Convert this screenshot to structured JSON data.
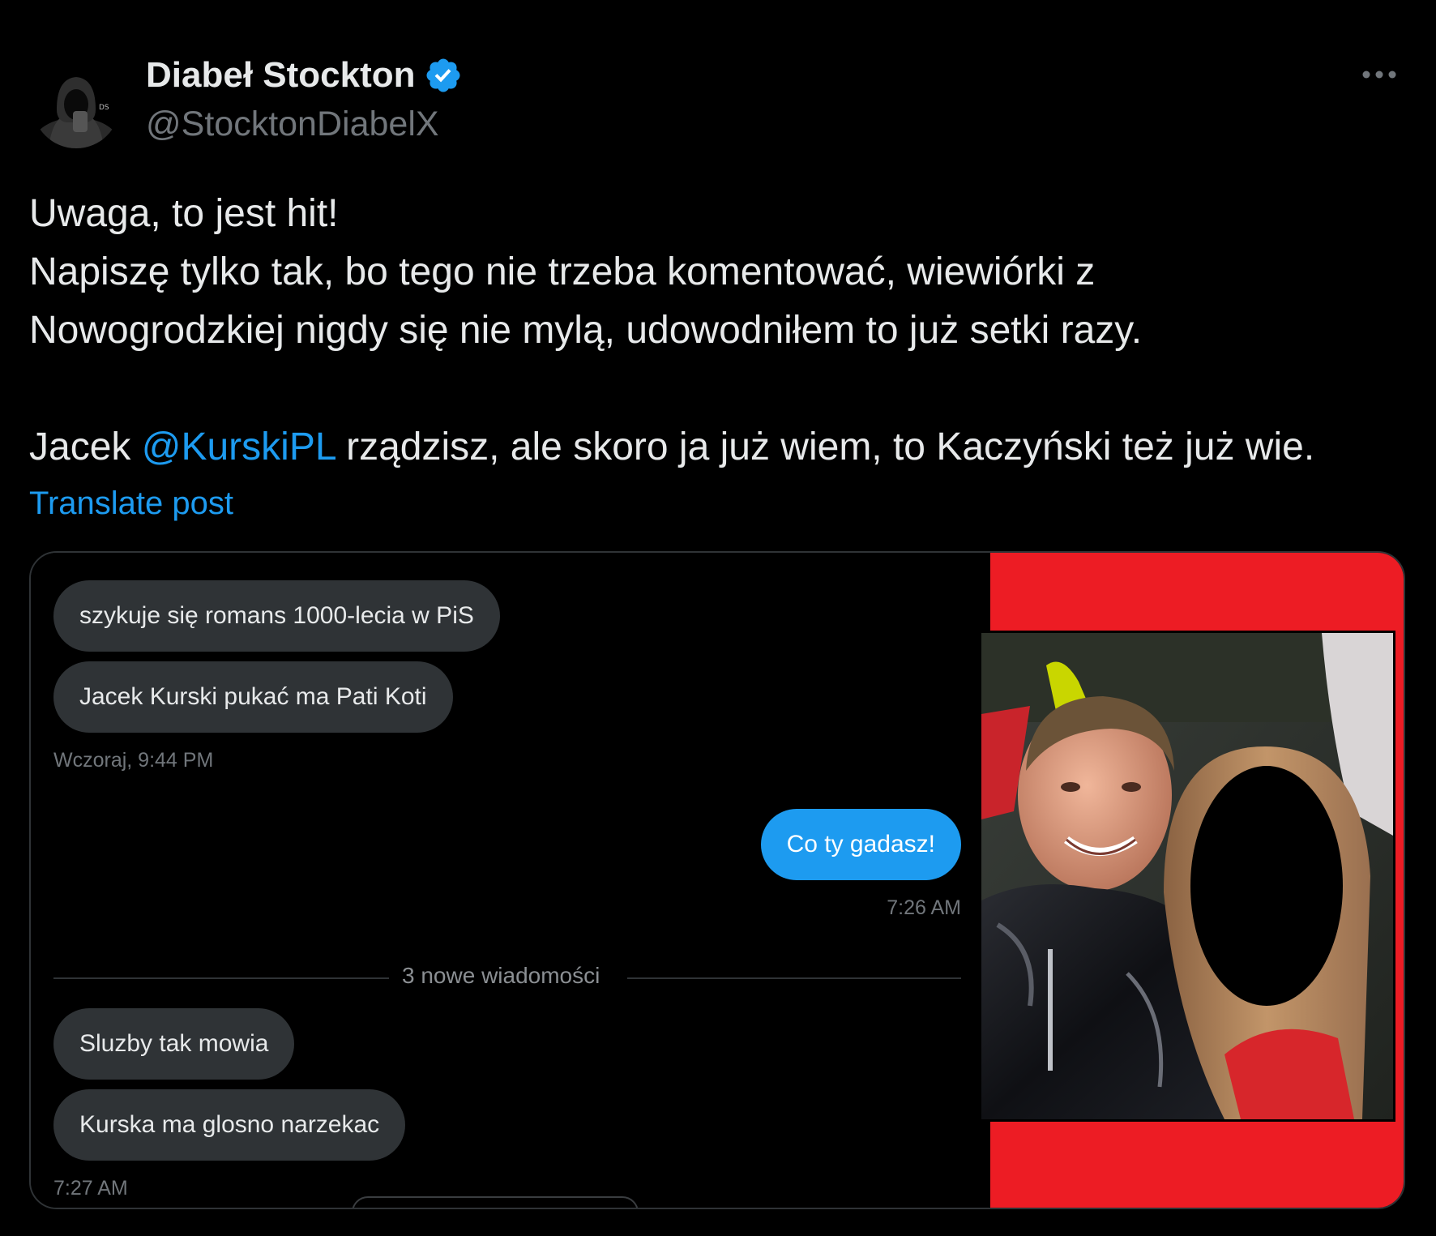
{
  "author": {
    "name": "Diabeł Stockton",
    "handle": "@StocktonDiabelX",
    "verified": true,
    "avatar_badge": "DS"
  },
  "post": {
    "line1": "Uwaga, to jest hit!",
    "line2": "Napiszę tylko tak, bo tego nie trzeba komentować, wiewiórki z",
    "line3": "Nowogrodzkiej nigdy się nie mylą, udowodniłem to już setki razy.",
    "line4_prefix": "Jacek ",
    "line4_mention": "@KurskiPL",
    "line4_suffix": " rządzisz, ale skoro ja już wiem, to Kaczyński też już wie."
  },
  "translate_label": "Translate post",
  "chat": {
    "messages": [
      {
        "text": "szykuje się romans 1000-lecia w PiS",
        "direction": "in"
      },
      {
        "text": "Jacek Kurski pukać ma Pati Koti",
        "direction": "in"
      },
      {
        "text": "Co ty gadasz!",
        "direction": "out"
      },
      {
        "text": "Sluzby tak mowia",
        "direction": "in"
      },
      {
        "text": "Kurska ma glosno narzekac",
        "direction": "in"
      }
    ],
    "timestamps": [
      "Wczoraj, 9:44 PM",
      "7:26 AM",
      "7:27 AM"
    ],
    "divider_label": "3 nowe wiadomości"
  },
  "colors": {
    "background": "#000000",
    "text": "#e7e9ea",
    "secondary": "#71767b",
    "accent": "#1d9bf0",
    "incoming_bubble": "#2f3336",
    "photo_background": "#ed1c24"
  },
  "icons": {
    "verified": "verified-badge-icon",
    "more": "more-dots-icon"
  }
}
